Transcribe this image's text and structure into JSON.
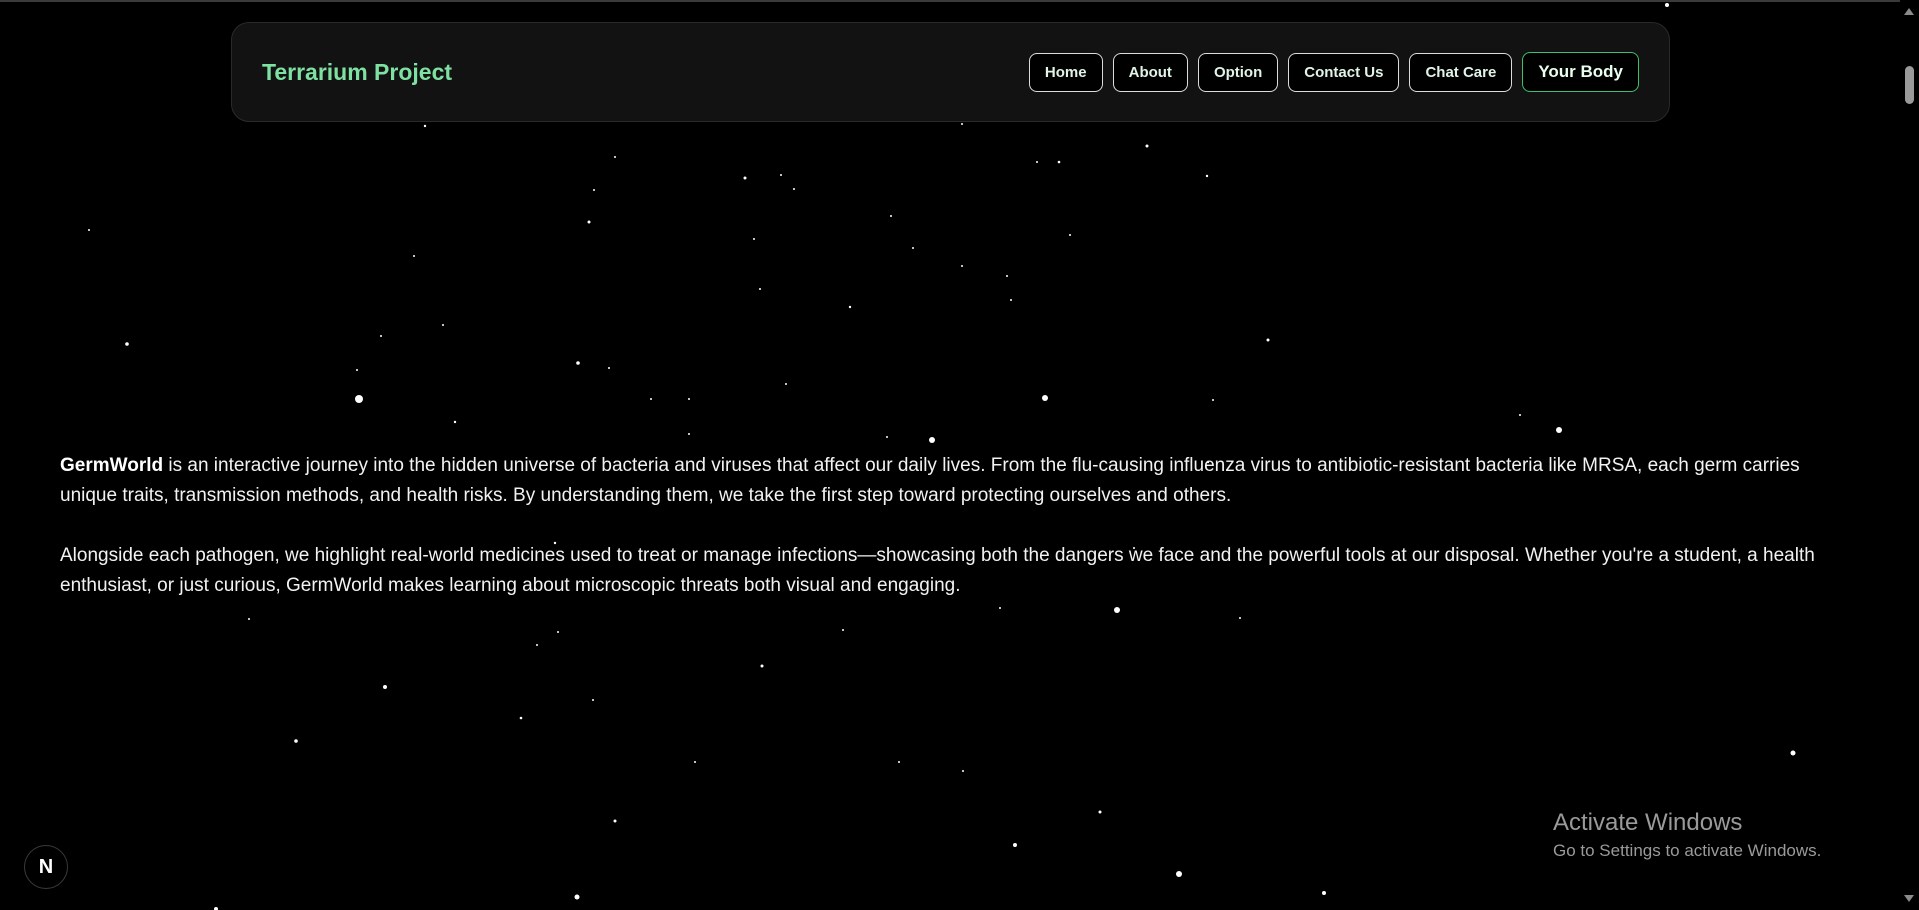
{
  "navbar": {
    "brand": "Terrarium Project",
    "links": [
      {
        "label": "Home"
      },
      {
        "label": "About"
      },
      {
        "label": "Option"
      },
      {
        "label": "Contact Us"
      },
      {
        "label": "Chat Care"
      },
      {
        "label": "Your Body"
      }
    ]
  },
  "content": {
    "p1_strong": "GermWorld",
    "p1_rest": " is an interactive journey into the hidden universe of bacteria and viruses that affect our daily lives. From the flu-causing influenza virus to antibiotic-resistant bacteria like MRSA, each germ carries unique traits, transmission methods, and health risks. By understanding them, we take the first step toward protecting ourselves and others.",
    "p2": "Alongside each pathogen, we highlight real-world medicines used to treat or manage infections—showcasing both the dangers we face and the powerful tools at our disposal. Whether you're a student, a health enthusiast, or just curious, GermWorld makes learning about microscopic threats both visual and engaging."
  },
  "badge": {
    "letter": "N"
  },
  "watermark": {
    "title": "Activate Windows",
    "subtitle": "Go to Settings to activate Windows."
  },
  "colors": {
    "background": "#000000",
    "brand": "#7ee0a1",
    "accent_border": "#3fbf6a"
  }
}
